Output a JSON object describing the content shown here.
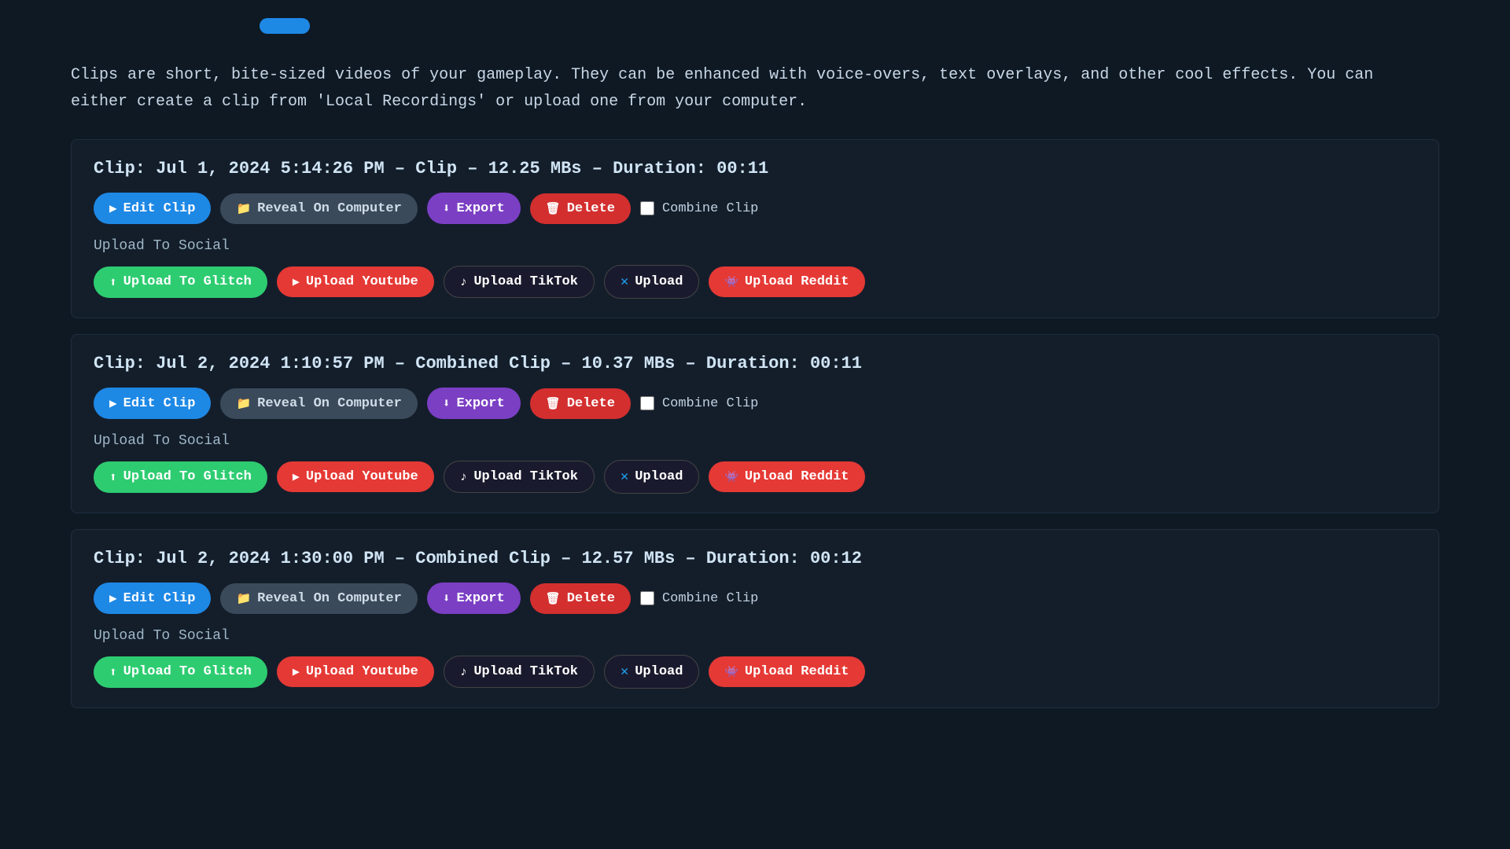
{
  "intro": {
    "text": "Clips are short, bite-sized videos of your gameplay. They can be enhanced with voice-overs,\ntext overlays, and other cool effects. You can either create a clip from 'Local Recordings'\nor upload one from your computer."
  },
  "clips": [
    {
      "id": "clip-1",
      "title_label": "Clip:",
      "title_info": "Jul 1, 2024 5:14:26 PM – Clip – 12.25 MBs – Duration: 00:11",
      "buttons": {
        "edit": "Edit Clip",
        "reveal": "Reveal On Computer",
        "export": "Export",
        "delete": "Delete",
        "combine": "Combine Clip"
      },
      "upload_label": "Upload To Social",
      "social": {
        "glitch": "Upload To Glitch",
        "youtube": "Upload Youtube",
        "tiktok": "Upload TikTok",
        "twitter": "Upload",
        "reddit": "Upload Reddit"
      }
    },
    {
      "id": "clip-2",
      "title_label": "Clip:",
      "title_info": "Jul 2, 2024 1:10:57 PM – Combined Clip – 10.37 MBs – Duration: 00:11",
      "buttons": {
        "edit": "Edit Clip",
        "reveal": "Reveal On Computer",
        "export": "Export",
        "delete": "Delete",
        "combine": "Combine Clip"
      },
      "upload_label": "Upload To Social",
      "social": {
        "glitch": "Upload To Glitch",
        "youtube": "Upload Youtube",
        "tiktok": "Upload TikTok",
        "twitter": "Upload",
        "reddit": "Upload Reddit"
      }
    },
    {
      "id": "clip-3",
      "title_label": "Clip:",
      "title_info": "Jul 2, 2024 1:30:00 PM – Combined Clip – 12.57 MBs – Duration: 00:12",
      "buttons": {
        "edit": "Edit Clip",
        "reveal": "Reveal On Computer",
        "export": "Export",
        "delete": "Delete",
        "combine": "Combine Clip"
      },
      "upload_label": "Upload To Social",
      "social": {
        "glitch": "Upload To Glitch",
        "youtube": "Upload Youtube",
        "tiktok": "Upload TikTok",
        "twitter": "Upload",
        "reddit": "Upload Reddit"
      }
    }
  ],
  "colors": {
    "edit": "#1e88e5",
    "reveal": "#3a4a5a",
    "export": "#7b3fc4",
    "delete": "#d32f2f",
    "glitch": "#2ecc71",
    "youtube": "#e53935",
    "tiktok": "#1a1a2e",
    "twitter": "#1a1a2e",
    "reddit": "#e53935"
  }
}
